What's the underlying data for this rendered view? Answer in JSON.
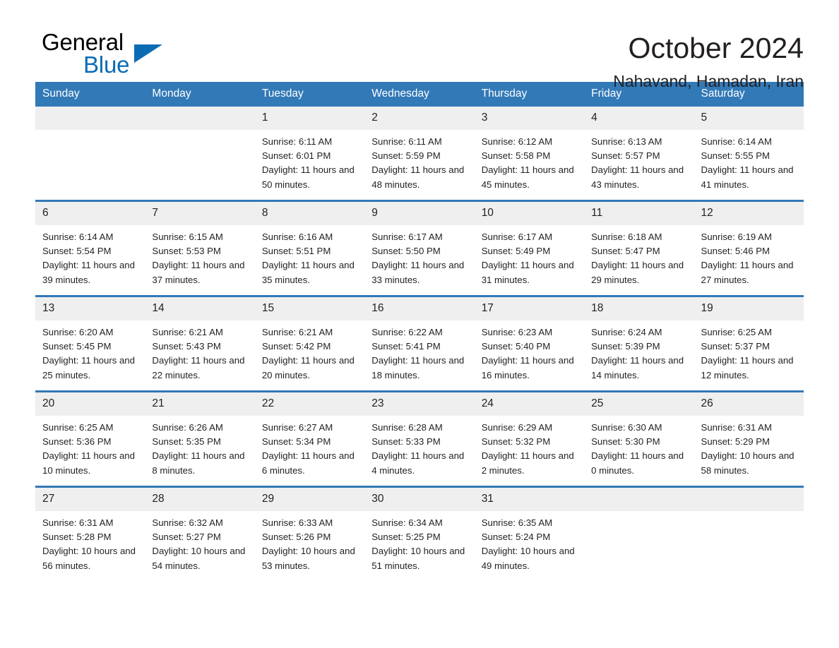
{
  "brand": {
    "name_part1": "General",
    "name_part2": "Blue",
    "accent_color": "#0b6cb4"
  },
  "header": {
    "title": "October 2024",
    "subtitle": "Nahavand, Hamadan, Iran"
  },
  "theme": {
    "header_row_bg": "#3279b7",
    "daynum_bg": "#efefef",
    "text_color": "#231f20"
  },
  "weekdays": [
    "Sunday",
    "Monday",
    "Tuesday",
    "Wednesday",
    "Thursday",
    "Friday",
    "Saturday"
  ],
  "labels": {
    "sunrise_prefix": "Sunrise:",
    "sunset_prefix": "Sunset:",
    "daylight_prefix": "Daylight:"
  },
  "weeks": [
    [
      {
        "day": "",
        "empty": true
      },
      {
        "day": "",
        "empty": true
      },
      {
        "day": "1",
        "sunrise": "Sunrise: 6:11 AM",
        "sunset": "Sunset: 6:01 PM",
        "daylight": "Daylight: 11 hours and 50 minutes."
      },
      {
        "day": "2",
        "sunrise": "Sunrise: 6:11 AM",
        "sunset": "Sunset: 5:59 PM",
        "daylight": "Daylight: 11 hours and 48 minutes."
      },
      {
        "day": "3",
        "sunrise": "Sunrise: 6:12 AM",
        "sunset": "Sunset: 5:58 PM",
        "daylight": "Daylight: 11 hours and 45 minutes."
      },
      {
        "day": "4",
        "sunrise": "Sunrise: 6:13 AM",
        "sunset": "Sunset: 5:57 PM",
        "daylight": "Daylight: 11 hours and 43 minutes."
      },
      {
        "day": "5",
        "sunrise": "Sunrise: 6:14 AM",
        "sunset": "Sunset: 5:55 PM",
        "daylight": "Daylight: 11 hours and 41 minutes."
      }
    ],
    [
      {
        "day": "6",
        "sunrise": "Sunrise: 6:14 AM",
        "sunset": "Sunset: 5:54 PM",
        "daylight": "Daylight: 11 hours and 39 minutes."
      },
      {
        "day": "7",
        "sunrise": "Sunrise: 6:15 AM",
        "sunset": "Sunset: 5:53 PM",
        "daylight": "Daylight: 11 hours and 37 minutes."
      },
      {
        "day": "8",
        "sunrise": "Sunrise: 6:16 AM",
        "sunset": "Sunset: 5:51 PM",
        "daylight": "Daylight: 11 hours and 35 minutes."
      },
      {
        "day": "9",
        "sunrise": "Sunrise: 6:17 AM",
        "sunset": "Sunset: 5:50 PM",
        "daylight": "Daylight: 11 hours and 33 minutes."
      },
      {
        "day": "10",
        "sunrise": "Sunrise: 6:17 AM",
        "sunset": "Sunset: 5:49 PM",
        "daylight": "Daylight: 11 hours and 31 minutes."
      },
      {
        "day": "11",
        "sunrise": "Sunrise: 6:18 AM",
        "sunset": "Sunset: 5:47 PM",
        "daylight": "Daylight: 11 hours and 29 minutes."
      },
      {
        "day": "12",
        "sunrise": "Sunrise: 6:19 AM",
        "sunset": "Sunset: 5:46 PM",
        "daylight": "Daylight: 11 hours and 27 minutes."
      }
    ],
    [
      {
        "day": "13",
        "sunrise": "Sunrise: 6:20 AM",
        "sunset": "Sunset: 5:45 PM",
        "daylight": "Daylight: 11 hours and 25 minutes."
      },
      {
        "day": "14",
        "sunrise": "Sunrise: 6:21 AM",
        "sunset": "Sunset: 5:43 PM",
        "daylight": "Daylight: 11 hours and 22 minutes."
      },
      {
        "day": "15",
        "sunrise": "Sunrise: 6:21 AM",
        "sunset": "Sunset: 5:42 PM",
        "daylight": "Daylight: 11 hours and 20 minutes."
      },
      {
        "day": "16",
        "sunrise": "Sunrise: 6:22 AM",
        "sunset": "Sunset: 5:41 PM",
        "daylight": "Daylight: 11 hours and 18 minutes."
      },
      {
        "day": "17",
        "sunrise": "Sunrise: 6:23 AM",
        "sunset": "Sunset: 5:40 PM",
        "daylight": "Daylight: 11 hours and 16 minutes."
      },
      {
        "day": "18",
        "sunrise": "Sunrise: 6:24 AM",
        "sunset": "Sunset: 5:39 PM",
        "daylight": "Daylight: 11 hours and 14 minutes."
      },
      {
        "day": "19",
        "sunrise": "Sunrise: 6:25 AM",
        "sunset": "Sunset: 5:37 PM",
        "daylight": "Daylight: 11 hours and 12 minutes."
      }
    ],
    [
      {
        "day": "20",
        "sunrise": "Sunrise: 6:25 AM",
        "sunset": "Sunset: 5:36 PM",
        "daylight": "Daylight: 11 hours and 10 minutes."
      },
      {
        "day": "21",
        "sunrise": "Sunrise: 6:26 AM",
        "sunset": "Sunset: 5:35 PM",
        "daylight": "Daylight: 11 hours and 8 minutes."
      },
      {
        "day": "22",
        "sunrise": "Sunrise: 6:27 AM",
        "sunset": "Sunset: 5:34 PM",
        "daylight": "Daylight: 11 hours and 6 minutes."
      },
      {
        "day": "23",
        "sunrise": "Sunrise: 6:28 AM",
        "sunset": "Sunset: 5:33 PM",
        "daylight": "Daylight: 11 hours and 4 minutes."
      },
      {
        "day": "24",
        "sunrise": "Sunrise: 6:29 AM",
        "sunset": "Sunset: 5:32 PM",
        "daylight": "Daylight: 11 hours and 2 minutes."
      },
      {
        "day": "25",
        "sunrise": "Sunrise: 6:30 AM",
        "sunset": "Sunset: 5:30 PM",
        "daylight": "Daylight: 11 hours and 0 minutes."
      },
      {
        "day": "26",
        "sunrise": "Sunrise: 6:31 AM",
        "sunset": "Sunset: 5:29 PM",
        "daylight": "Daylight: 10 hours and 58 minutes."
      }
    ],
    [
      {
        "day": "27",
        "sunrise": "Sunrise: 6:31 AM",
        "sunset": "Sunset: 5:28 PM",
        "daylight": "Daylight: 10 hours and 56 minutes."
      },
      {
        "day": "28",
        "sunrise": "Sunrise: 6:32 AM",
        "sunset": "Sunset: 5:27 PM",
        "daylight": "Daylight: 10 hours and 54 minutes."
      },
      {
        "day": "29",
        "sunrise": "Sunrise: 6:33 AM",
        "sunset": "Sunset: 5:26 PM",
        "daylight": "Daylight: 10 hours and 53 minutes."
      },
      {
        "day": "30",
        "sunrise": "Sunrise: 6:34 AM",
        "sunset": "Sunset: 5:25 PM",
        "daylight": "Daylight: 10 hours and 51 minutes."
      },
      {
        "day": "31",
        "sunrise": "Sunrise: 6:35 AM",
        "sunset": "Sunset: 5:24 PM",
        "daylight": "Daylight: 10 hours and 49 minutes."
      },
      {
        "day": "",
        "empty": true
      },
      {
        "day": "",
        "empty": true
      }
    ]
  ]
}
